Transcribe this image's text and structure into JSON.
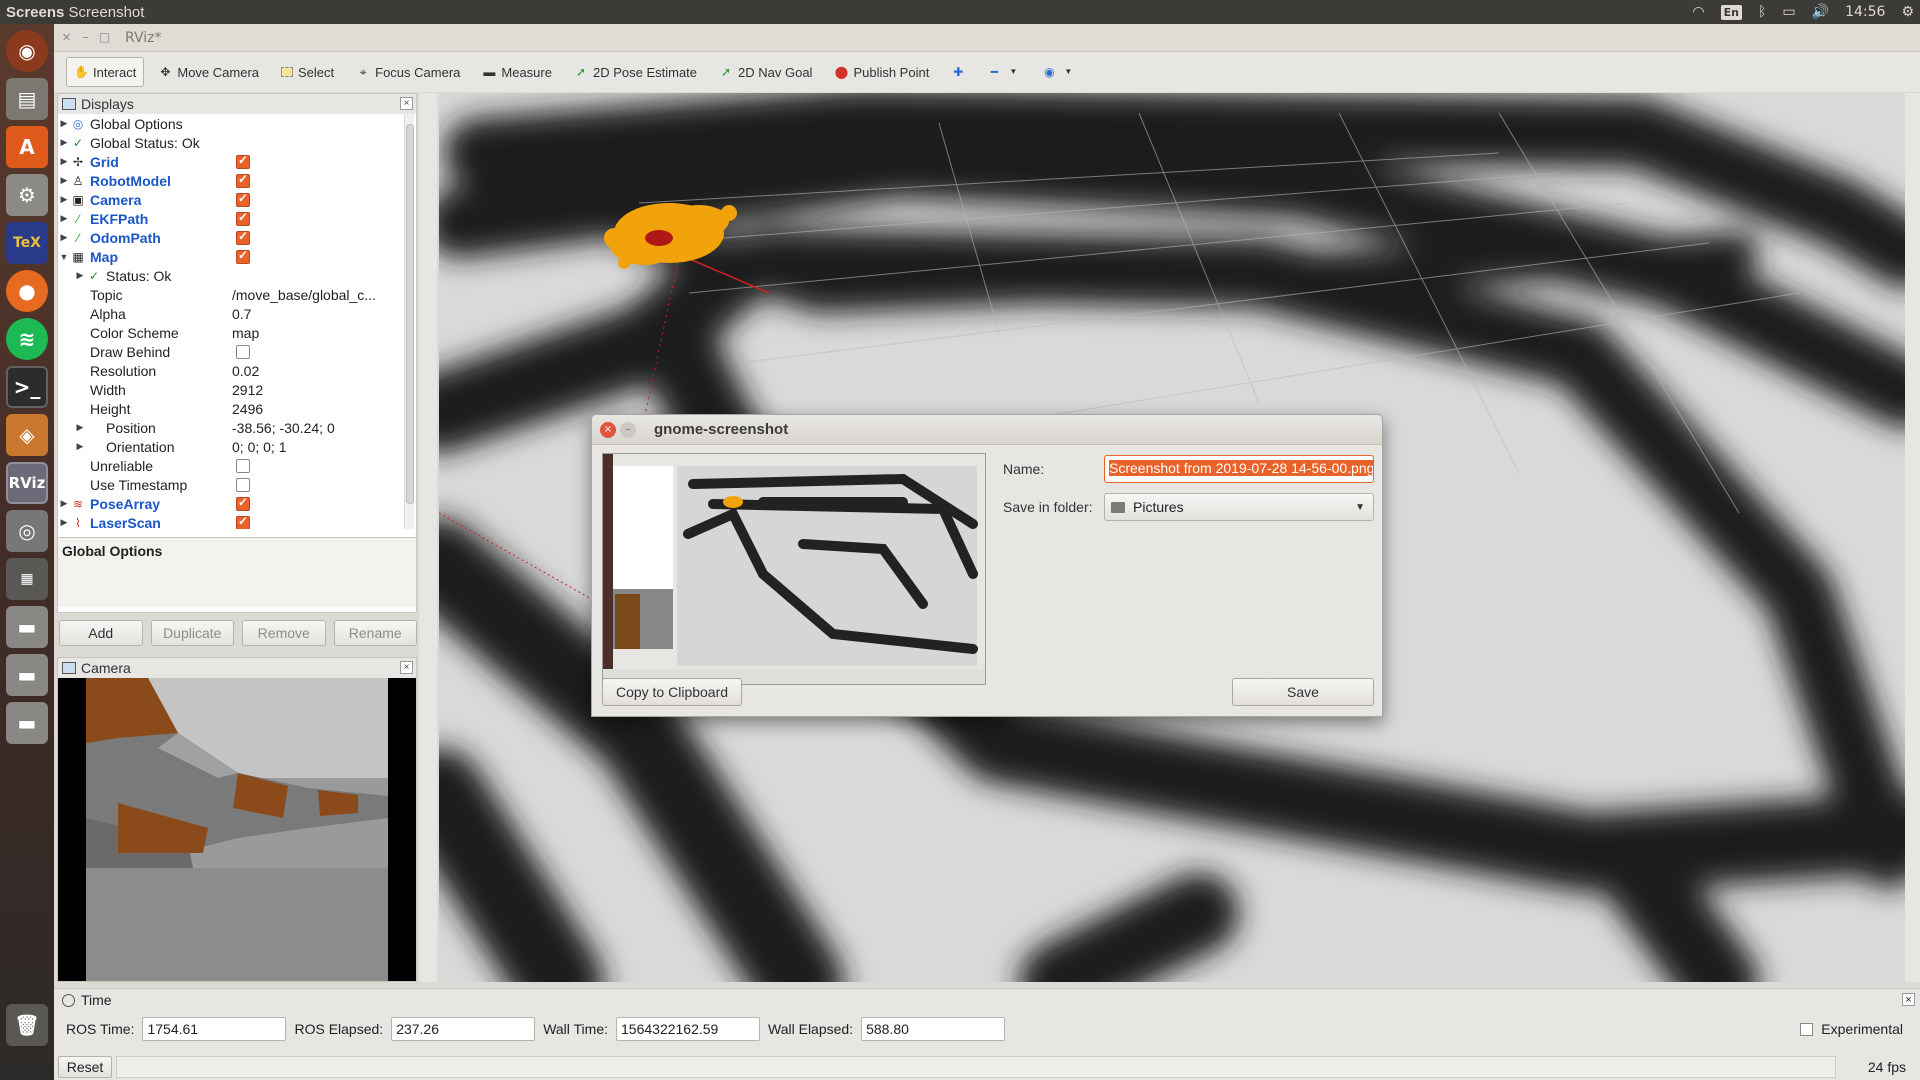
{
  "top_panel": {
    "title_bold": "Screens",
    "title_rest": "Screenshot",
    "keyboard": "En",
    "clock": "14:56"
  },
  "launcher": {
    "items": [
      "dash-icon",
      "files-icon",
      "software-center-icon",
      "settings-icon",
      "texmaker-icon",
      "firefox-icon",
      "spotify-icon",
      "terminal-icon",
      "package-icon",
      "rviz-icon",
      "screenshot-icon",
      "workspace-icon",
      "drive-icon",
      "drive-icon",
      "drive-icon",
      "trash-icon"
    ],
    "rviz_label": "RViz",
    "tex_label": "TeX"
  },
  "window": {
    "title": "RViz*"
  },
  "toolbar": {
    "interact": "Interact",
    "move_camera": "Move Camera",
    "select": "Select",
    "focus_camera": "Focus Camera",
    "measure": "Measure",
    "pose_estimate": "2D Pose Estimate",
    "nav_goal": "2D Nav Goal",
    "publish_point": "Publish Point"
  },
  "displays": {
    "title": "Displays",
    "rows": [
      {
        "name": "Global Options",
        "value": ""
      },
      {
        "name": "Global Status: Ok",
        "value": ""
      },
      {
        "name": "Grid",
        "value": ""
      },
      {
        "name": "RobotModel",
        "value": ""
      },
      {
        "name": "Camera",
        "value": ""
      },
      {
        "name": "EKFPath",
        "value": ""
      },
      {
        "name": "OdomPath",
        "value": ""
      },
      {
        "name": "Map",
        "value": ""
      },
      {
        "name": "Status: Ok",
        "value": ""
      },
      {
        "name": "Topic",
        "value": "/move_base/global_c..."
      },
      {
        "name": "Alpha",
        "value": "0.7"
      },
      {
        "name": "Color Scheme",
        "value": "map"
      },
      {
        "name": "Draw Behind",
        "value": ""
      },
      {
        "name": "Resolution",
        "value": "0.02"
      },
      {
        "name": "Width",
        "value": "2912"
      },
      {
        "name": "Height",
        "value": "2496"
      },
      {
        "name": "Position",
        "value": "-38.56; -30.24; 0"
      },
      {
        "name": "Orientation",
        "value": "0; 0; 0; 1"
      },
      {
        "name": "Unreliable",
        "value": ""
      },
      {
        "name": "Use Timestamp",
        "value": ""
      },
      {
        "name": "PoseArray",
        "value": ""
      },
      {
        "name": "LaserScan",
        "value": ""
      }
    ],
    "description_title": "Global Options",
    "buttons": {
      "add": "Add",
      "duplicate": "Duplicate",
      "remove": "Remove",
      "rename": "Rename"
    }
  },
  "camera_panel": {
    "title": "Camera"
  },
  "dialog": {
    "title": "gnome-screenshot",
    "name_label": "Name:",
    "name_value": "Screenshot from 2019-07-28 14-56-00.png",
    "folder_label": "Save in folder:",
    "folder_value": "Pictures",
    "copy_button": "Copy to Clipboard",
    "save_button": "Save"
  },
  "time_panel": {
    "title": "Time",
    "ros_time_label": "ROS Time:",
    "ros_time": "1754.61",
    "ros_elapsed_label": "ROS Elapsed:",
    "ros_elapsed": "237.26",
    "wall_time_label": "Wall Time:",
    "wall_time": "1564322162.59",
    "wall_elapsed_label": "Wall Elapsed:",
    "wall_elapsed": "588.80",
    "experimental": "Experimental",
    "reset": "Reset",
    "fps": "24 fps"
  },
  "colors": {
    "accent": "#e8622a",
    "link_blue": "#1a56c8",
    "panel_bg": "#e8e6e2"
  }
}
